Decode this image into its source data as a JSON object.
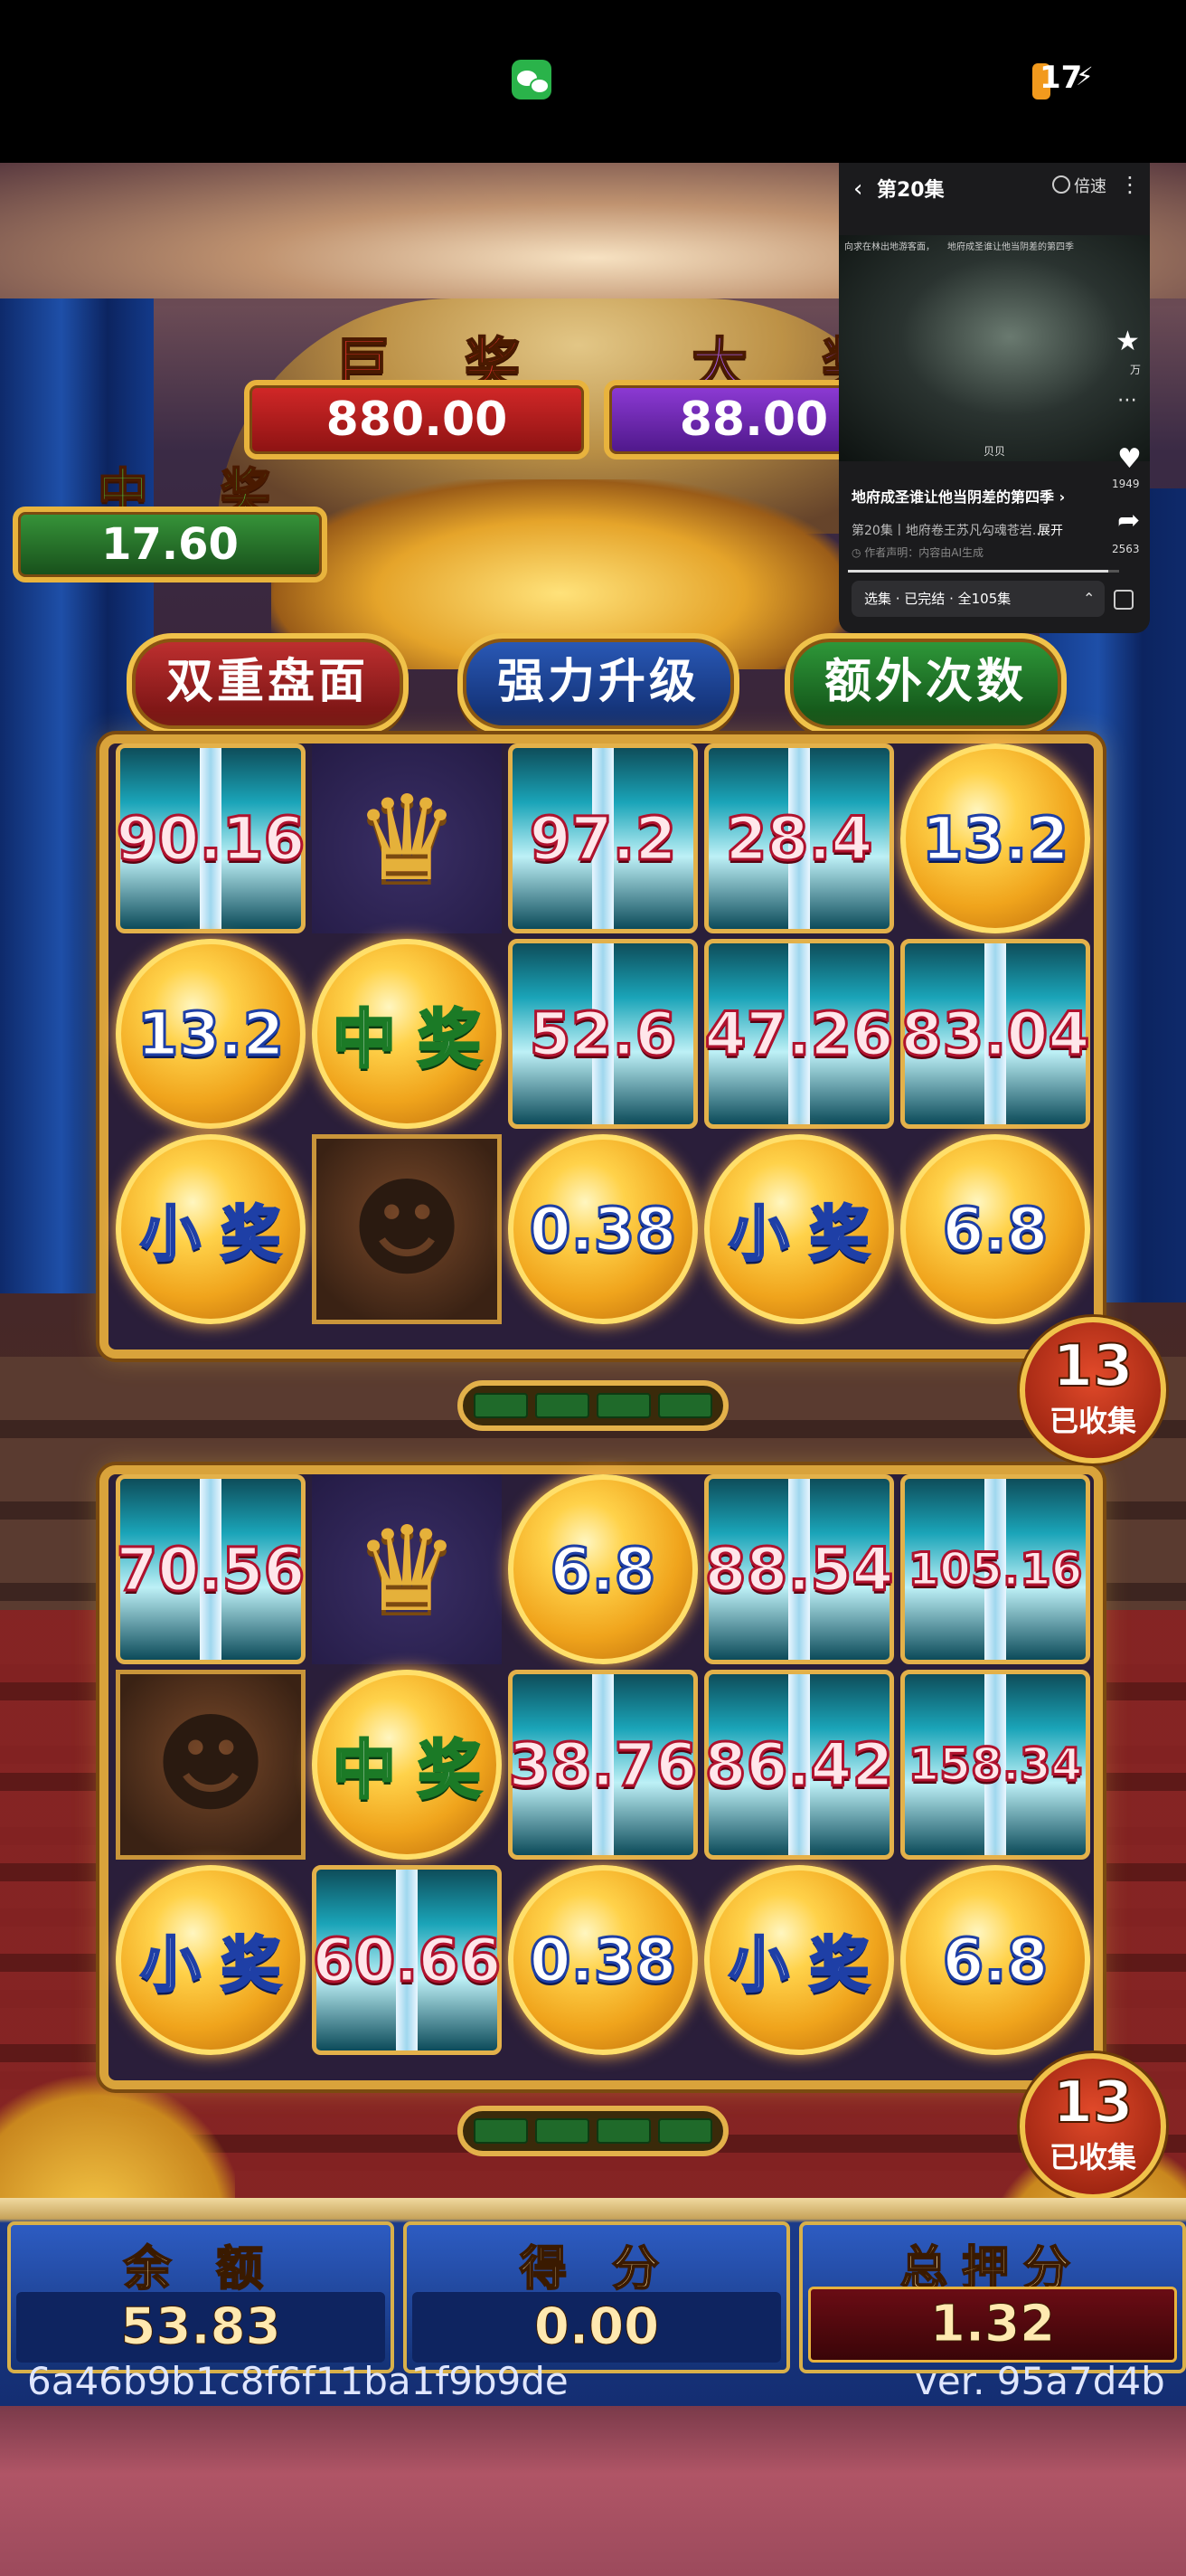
{
  "status_bar": {
    "battery": "17",
    "battery_color": "#f29a1d",
    "app_icon": "wechat-icon",
    "charge_icon": "⚡"
  },
  "jackpots": {
    "grand": {
      "title": "巨 奖",
      "value": "880.00",
      "color": "#d32828"
    },
    "major": {
      "title": "大 奖",
      "value": "88.00",
      "color": "#8e3bd6"
    },
    "minor": {
      "title": "中 奖",
      "value": "17.60",
      "color": "#37963a"
    }
  },
  "features": [
    "双重盘面",
    "强力升级",
    "额外次数"
  ],
  "reels": [
    {
      "collected": "13",
      "collected_label": "已收集",
      "progress": {
        "filled": 0,
        "total": 4
      },
      "rows": [
        [
          {
            "type": "sword",
            "label": "90.16"
          },
          {
            "type": "crown",
            "label": ""
          },
          {
            "type": "sword",
            "label": "97.2"
          },
          {
            "type": "sword",
            "label": "28.4"
          },
          {
            "type": "orb",
            "label": "13.2"
          }
        ],
        [
          {
            "type": "orb",
            "label": "13.2"
          },
          {
            "type": "orb-green",
            "label": "中 奖"
          },
          {
            "type": "sword",
            "label": "52.6"
          },
          {
            "type": "sword",
            "label": "47.26"
          },
          {
            "type": "sword",
            "label": "83.04"
          }
        ],
        [
          {
            "type": "orb",
            "label": "小 奖"
          },
          {
            "type": "king",
            "label": ""
          },
          {
            "type": "orb",
            "label": "0.38"
          },
          {
            "type": "orb",
            "label": "小 奖"
          },
          {
            "type": "orb",
            "label": "6.8"
          }
        ]
      ]
    },
    {
      "collected": "13",
      "collected_label": "已收集",
      "progress": {
        "filled": 0,
        "total": 4
      },
      "rows": [
        [
          {
            "type": "sword",
            "label": "70.56"
          },
          {
            "type": "crown",
            "label": ""
          },
          {
            "type": "orb",
            "label": "6.8"
          },
          {
            "type": "sword",
            "label": "88.54"
          },
          {
            "type": "sword",
            "label": "105.16"
          }
        ],
        [
          {
            "type": "king",
            "label": ""
          },
          {
            "type": "orb-green",
            "label": "中 奖"
          },
          {
            "type": "sword",
            "label": "38.76"
          },
          {
            "type": "sword",
            "label": "86.42"
          },
          {
            "type": "sword",
            "label": "158.34"
          }
        ],
        [
          {
            "type": "orb",
            "label": "小 奖"
          },
          {
            "type": "sword",
            "label": "60.66"
          },
          {
            "type": "orb",
            "label": "0.38"
          },
          {
            "type": "orb",
            "label": "小 奖"
          },
          {
            "type": "orb",
            "label": "6.8"
          }
        ]
      ]
    }
  ],
  "panel": {
    "balance_label": "余 额",
    "balance": "53.83",
    "score_label": "得 分",
    "score": "0.00",
    "bet_label": "总押分",
    "bet": "1.32"
  },
  "footer": {
    "hash": "6a46b9b1c8f6f11ba1f9b9de",
    "version": "ver. 95a7d4b"
  },
  "mini_window": {
    "back_icon": "‹",
    "episode": "第20集",
    "speed": "倍速",
    "more_icon": "⋮",
    "caption_left": "向求在林出地游客面，",
    "caption_right": "地府成圣谁让他当阴差的第四季",
    "watermark": "贝贝",
    "side_count": "万",
    "likes": "1949",
    "shares": "2563",
    "title": "地府成圣谁让他当阴差的第四季 ›",
    "subtitle": "第20集丨地府卷王苏凡勾魂苍岩...",
    "expand": "展开",
    "author": "◷ 作者声明：内容由AI生成",
    "playlist": "选集 · 已完结 · 全105集",
    "progress": 0.96
  }
}
